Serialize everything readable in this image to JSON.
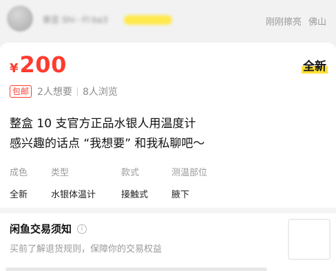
{
  "seller": {
    "name": "章芸 Shi···Fl·ba3",
    "time": "刚刚擦亮",
    "city": "佛山"
  },
  "item": {
    "currency": "¥",
    "price": "200",
    "condition": "全新",
    "free_shipping": "包邮",
    "wants": "2人想要",
    "views": "8人浏览",
    "title_line1": "整盒 10 支官方正品水银人用温度计",
    "title_line2": "感兴趣的话点 “我想要” 和我私聊吧～"
  },
  "attributes": [
    {
      "key": "成色",
      "value": "全新"
    },
    {
      "key": "类型",
      "value": "水银体温计"
    },
    {
      "key": "款式",
      "value": "接触式"
    },
    {
      "key": "测温部位",
      "value": "腋下"
    }
  ],
  "notice": {
    "title": "闲鱼交易须知",
    "icon": "info-icon",
    "subtitle": "买前了解退货规则，保障你的交易权益"
  },
  "colors": {
    "price_red": "#ff3b2f",
    "highlight_yellow": "#ffe03a"
  }
}
